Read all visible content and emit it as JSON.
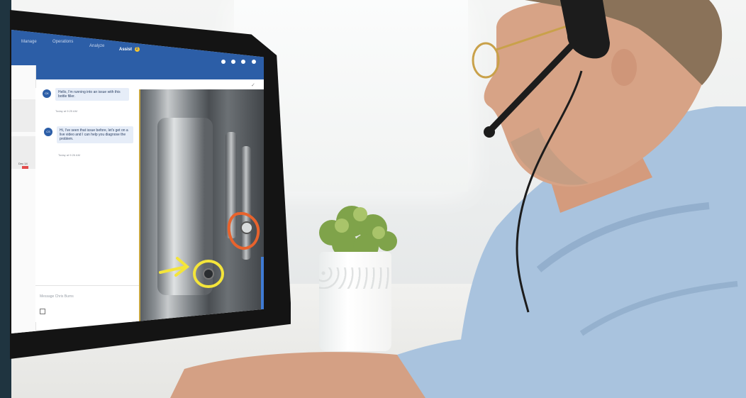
{
  "app": {
    "nav": {
      "manage": "Manage",
      "operations": "Operations",
      "analyze": "Analyze",
      "assist": "Assist",
      "assist_badge": "2"
    },
    "sidebar": {
      "item_label": "Dec 14",
      "colors": {
        "tag": "#e34b4b"
      }
    },
    "chat": {
      "messages": [
        {
          "avatar": "CK",
          "text": "Hello, I'm running into an issue with this bottle filler.",
          "time": "Today at 9:25 AM"
        },
        {
          "avatar": "CS",
          "text": "Hi, I've seen that issue before, let's get on a live video and I can help you diagnose the problem.",
          "time": "Today at 9:26 AM"
        }
      ],
      "input_placeholder": "Message Chris Burns"
    },
    "colors": {
      "topbar": "#2c5ea7",
      "bubble": "#e6edf8",
      "annotation_yellow": "#f4e53a",
      "annotation_orange": "#e8632d"
    }
  },
  "icons": [
    "headset-icon",
    "settings-icon",
    "help-icon",
    "profile-icon",
    "close-icon",
    "attach-icon"
  ]
}
